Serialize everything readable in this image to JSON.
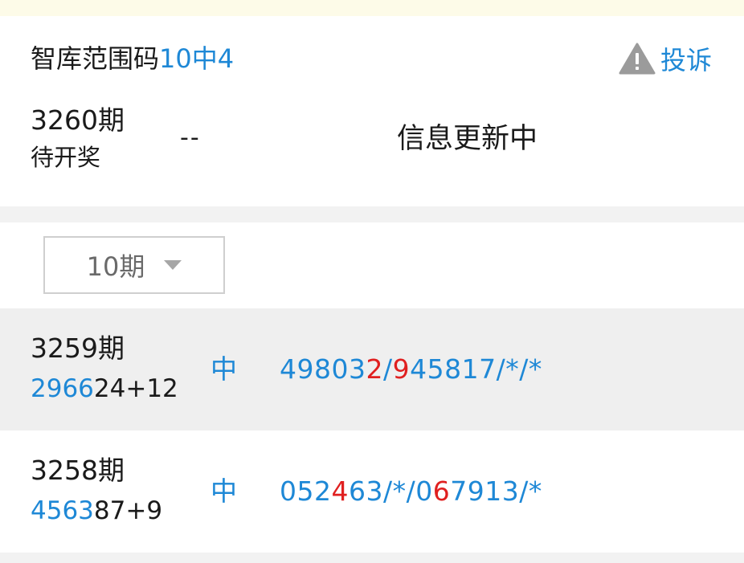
{
  "header": {
    "title_prefix": "智库范围码",
    "title_highlight": "10中4",
    "complain_label": "投诉",
    "complain_icon": "warning-triangle-icon"
  },
  "current": {
    "period": "3260期",
    "status": "待开奖",
    "result": "--",
    "info": "信息更新中"
  },
  "filter": {
    "selected": "10期",
    "icon": "chevron-down-icon"
  },
  "colors": {
    "accent": "#1e88d6",
    "hit": "#e02020",
    "text": "#1a1a1a"
  },
  "records": [
    {
      "period": "3259期",
      "result_highlight": "2966",
      "result_rest": "24+12",
      "status": "中",
      "numbers": [
        {
          "text": "49803",
          "hit": false
        },
        {
          "text": "2",
          "hit": true
        },
        {
          "text": "/",
          "hit": false
        },
        {
          "text": "9",
          "hit": true
        },
        {
          "text": "45817/*/*",
          "hit": false
        }
      ]
    },
    {
      "period": "3258期",
      "result_highlight": "4563",
      "result_rest": "87+9",
      "status": "中",
      "numbers": [
        {
          "text": "052",
          "hit": false
        },
        {
          "text": "4",
          "hit": true
        },
        {
          "text": "63/*/0",
          "hit": false
        },
        {
          "text": "6",
          "hit": true
        },
        {
          "text": "7913/*",
          "hit": false
        }
      ]
    }
  ]
}
